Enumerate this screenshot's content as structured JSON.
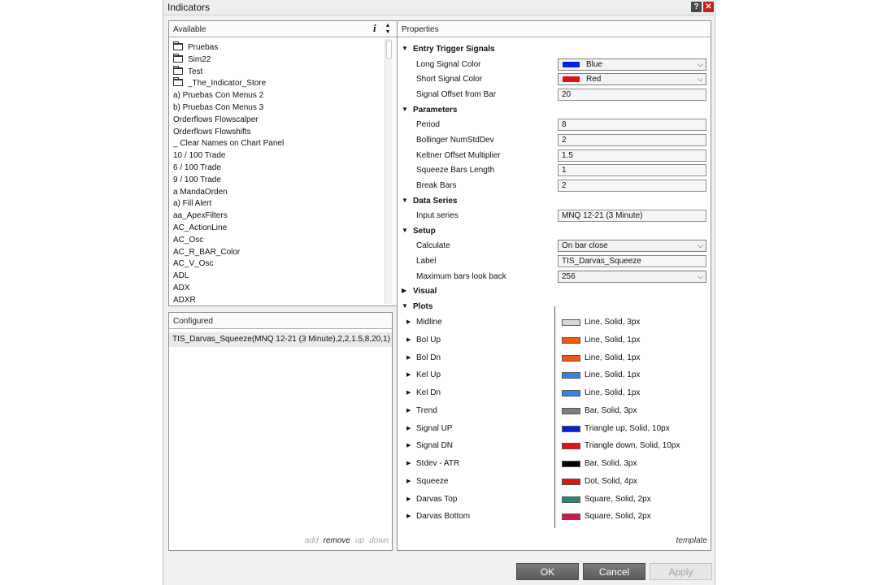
{
  "window": {
    "title": "Indicators",
    "help_glyph": "?",
    "close_glyph": "✕"
  },
  "available": {
    "header": "Available",
    "info_glyph": "i",
    "items": [
      {
        "label": "Pruebas",
        "folder": true
      },
      {
        "label": "Sim22",
        "folder": true
      },
      {
        "label": "Test",
        "folder": true
      },
      {
        "label": "_The_Indicator_Store",
        "folder": true
      },
      {
        "label": "a) Pruebas Con Menus 2",
        "folder": false
      },
      {
        "label": "b) Pruebas Con Menus 3",
        "folder": false
      },
      {
        "label": "Orderflows Flowscalper",
        "folder": false
      },
      {
        "label": "Orderflows Flowshifts",
        "folder": false
      },
      {
        "label": "_ Clear Names on Chart Panel",
        "folder": false
      },
      {
        "label": "10 / 100 Trade",
        "folder": false
      },
      {
        "label": "6 / 100 Trade",
        "folder": false
      },
      {
        "label": "9 / 100 Trade",
        "folder": false
      },
      {
        "label": "a MandaOrden",
        "folder": false
      },
      {
        "label": "a) Fill Alert",
        "folder": false
      },
      {
        "label": "aa_ApexFilters",
        "folder": false
      },
      {
        "label": "AC_ActionLine",
        "folder": false
      },
      {
        "label": "AC_Osc",
        "folder": false
      },
      {
        "label": "AC_R_BAR_Color",
        "folder": false
      },
      {
        "label": "AC_V_Osc",
        "folder": false
      },
      {
        "label": "ADL",
        "folder": false
      },
      {
        "label": "ADX",
        "folder": false
      },
      {
        "label": "ADXR",
        "folder": false
      }
    ]
  },
  "configured": {
    "header": "Configured",
    "item": "TIS_Darvas_Squeeze(MNQ 12-21 (3 Minute),2,2,1.5,8,20,1)",
    "actions": {
      "add": "add",
      "remove": "remove",
      "up": "up",
      "down": "down"
    }
  },
  "properties": {
    "header": "Properties",
    "template_label": "template",
    "rows": [
      {
        "kind": "category",
        "label": "Entry Trigger Signals",
        "expanded": true
      },
      {
        "kind": "select",
        "label": "Long Signal Color",
        "value": "Blue",
        "swatch": "#0022dd"
      },
      {
        "kind": "select",
        "label": "Short Signal Color",
        "value": "Red",
        "swatch": "#e01010"
      },
      {
        "kind": "field",
        "label": "Signal Offset from Bar",
        "value": "20"
      },
      {
        "kind": "category",
        "label": "Parameters",
        "expanded": true
      },
      {
        "kind": "field",
        "label": "Period",
        "value": "8"
      },
      {
        "kind": "field",
        "label": "Bollinger NumStdDev",
        "value": "2"
      },
      {
        "kind": "field",
        "label": "Keltner Offset Multiplier",
        "value": "1.5"
      },
      {
        "kind": "field",
        "label": "Squeeze Bars Length",
        "value": "1"
      },
      {
        "kind": "field",
        "label": "Break Bars",
        "value": "2"
      },
      {
        "kind": "category",
        "label": "Data Series",
        "expanded": true
      },
      {
        "kind": "field",
        "label": "Input series",
        "value": "MNQ 12-21 (3 Minute)"
      },
      {
        "kind": "category",
        "label": "Setup",
        "expanded": true
      },
      {
        "kind": "select",
        "label": "Calculate",
        "value": "On bar close"
      },
      {
        "kind": "field",
        "label": "Label",
        "value": "TIS_Darvas_Squeeze"
      },
      {
        "kind": "select",
        "label": "Maximum bars look back",
        "value": "256"
      },
      {
        "kind": "category",
        "label": "Visual",
        "expanded": false
      },
      {
        "kind": "category",
        "label": "Plots",
        "expanded": true
      }
    ],
    "plots": [
      {
        "label": "Midline",
        "style": "Line, Solid, 3px",
        "color": "#d8d8d8"
      },
      {
        "label": "Bol Up",
        "style": "Line, Solid, 1px",
        "color": "#f05a10"
      },
      {
        "label": "Bol Dn",
        "style": "Line, Solid, 1px",
        "color": "#f05a10"
      },
      {
        "label": "Kel Up",
        "style": "Line, Solid, 1px",
        "color": "#2e86e8"
      },
      {
        "label": "Kel Dn",
        "style": "Line, Solid, 1px",
        "color": "#2e86e8"
      },
      {
        "label": "Trend",
        "style": "Bar, Solid, 3px",
        "color": "#808080"
      },
      {
        "label": "Signal UP",
        "style": "Triangle up, Solid, 10px",
        "color": "#0a1ed8"
      },
      {
        "label": "Signal DN",
        "style": "Triangle down, Solid, 10px",
        "color": "#e01414"
      },
      {
        "label": "Stdev - ATR",
        "style": "Bar, Solid, 3px",
        "color": "#000000"
      },
      {
        "label": "Squeeze",
        "style": "Dot, Solid, 4px",
        "color": "#e01414"
      },
      {
        "label": "Darvas Top",
        "style": "Square, Solid, 2px",
        "color": "#1f8a80"
      },
      {
        "label": "Darvas Bottom",
        "style": "Square, Solid, 2px",
        "color": "#d01848"
      }
    ]
  },
  "buttons": {
    "ok": "OK",
    "cancel": "Cancel",
    "apply": "Apply"
  }
}
